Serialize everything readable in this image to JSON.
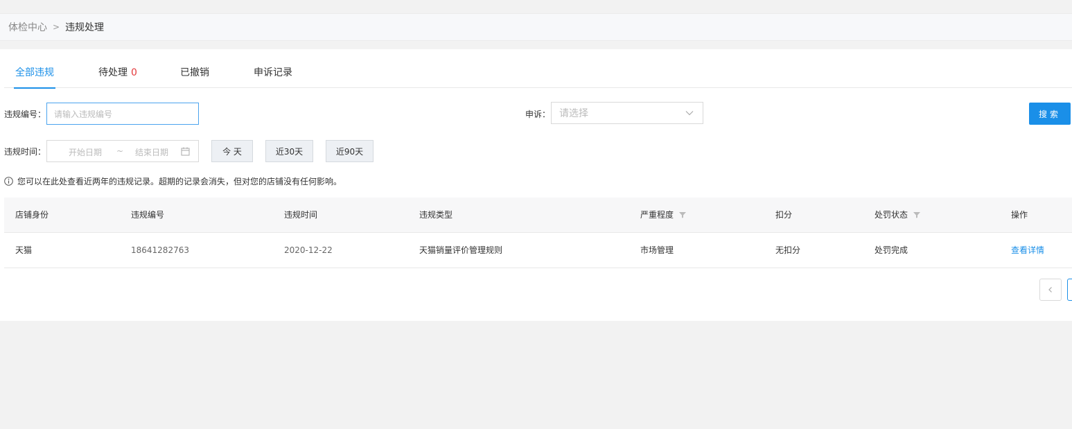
{
  "breadcrumb": {
    "parent": "体检中心",
    "separator": ">",
    "current": "违规处理"
  },
  "tabs": [
    {
      "label": "全部违规",
      "active": true
    },
    {
      "label": "待处理",
      "count": "0"
    },
    {
      "label": "已撤销"
    },
    {
      "label": "申诉记录"
    }
  ],
  "filters": {
    "violation_no_label": "违规编号：",
    "violation_no_placeholder": "请输入违规编号",
    "appeal_label": "申诉：",
    "appeal_placeholder": "请选择",
    "search_label": "搜索",
    "time_label": "违规时间：",
    "start_placeholder": "开始日期",
    "range_sep": "~",
    "end_placeholder": "结束日期",
    "quick": [
      "今 天",
      "近30天",
      "近90天"
    ]
  },
  "notice": "您可以在此处查看近两年的违规记录。超期的记录会消失，但对您的店铺没有任何影响。",
  "table": {
    "headers": [
      "店铺身份",
      "违规编号",
      "违规时间",
      "违规类型",
      "严重程度",
      "扣分",
      "处罚状态",
      "操作"
    ],
    "rows": [
      [
        "天猫",
        "18641282763",
        "2020-12-22",
        "天猫销量评价管理规则",
        "市场管理",
        "无扣分",
        "处罚完成",
        "查看详情"
      ]
    ]
  },
  "colors": {
    "accent": "#1a8fe8",
    "count": "#e4393c"
  }
}
